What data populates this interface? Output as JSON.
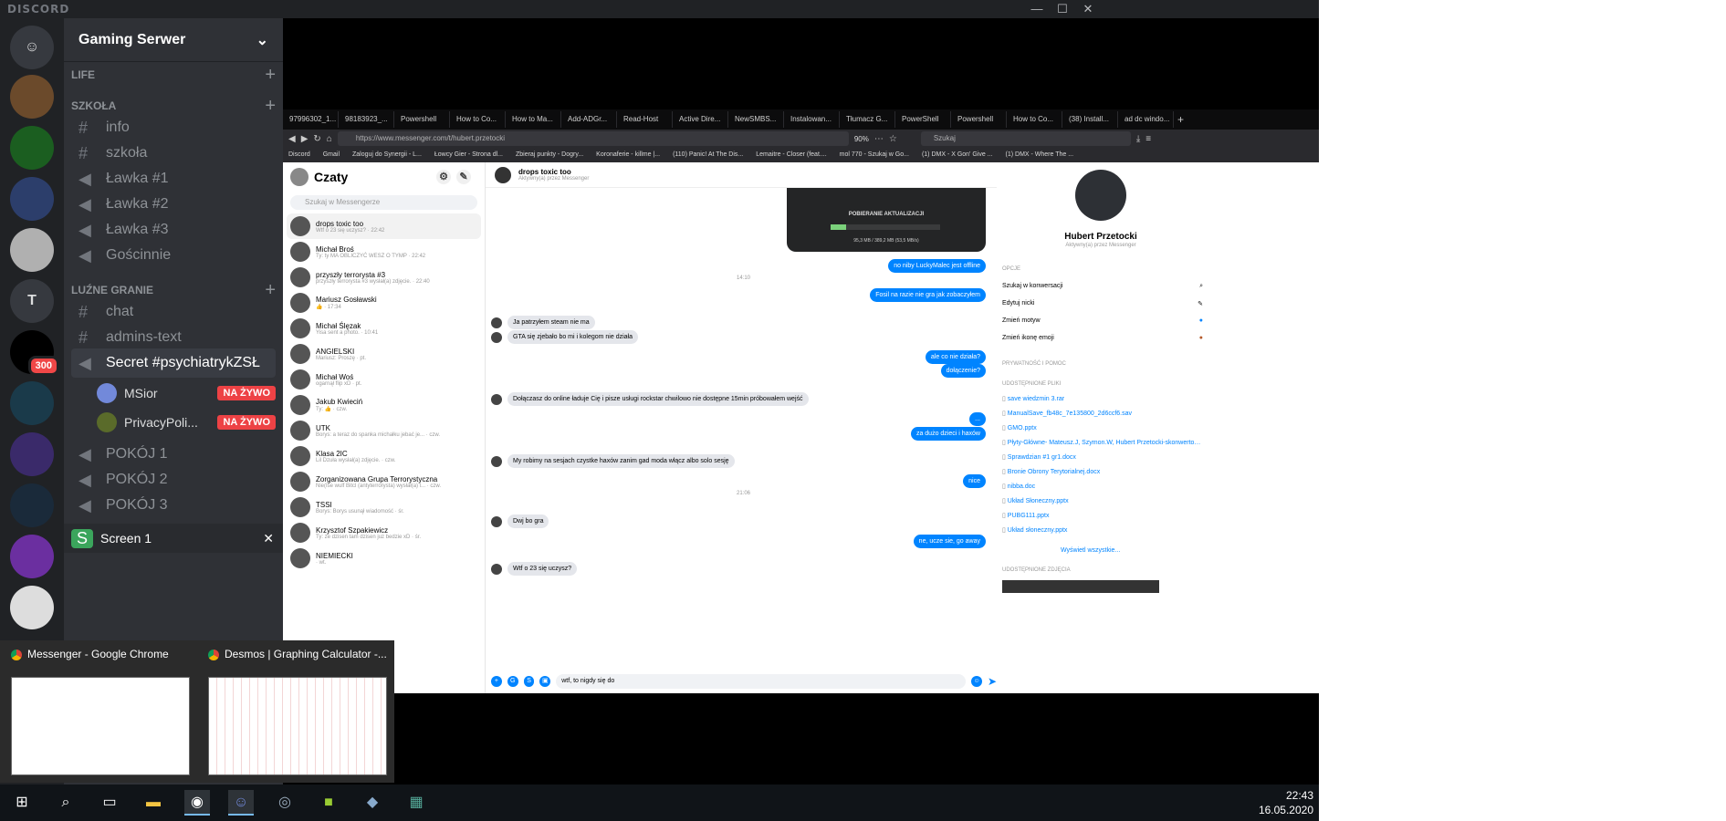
{
  "discord": {
    "logo": "DISCORD",
    "server_name": "Gaming Serwer",
    "categories": [
      "LIFE",
      "SZKOŁA",
      "LUŹNE GRANIE"
    ],
    "channels_szkola": [
      "info",
      "szkoła",
      "Ławka #1",
      "Ławka #2",
      "Ławka #3",
      "Gościnnie"
    ],
    "channels_luzne": [
      "chat",
      "admins-text",
      "Secret #psychiatrykZSŁ"
    ],
    "voice_users": [
      {
        "name": "MSior",
        "badge": "NA ŻYWO"
      },
      {
        "name": "PrivacyPoli...",
        "badge": "NA ŻYWO"
      }
    ],
    "more_channels": [
      "POKÓJ 1",
      "POKÓJ 2",
      "POKÓJ 3"
    ],
    "screen_share": "Screen 1",
    "server_letter": "T",
    "mention_count": "300"
  },
  "browser": {
    "tabs": [
      "97996302_1...",
      "98183923_...",
      "Powershell",
      "How to Co...",
      "How to Ma...",
      "Add-ADGr...",
      "Read-Host",
      "Active Dire...",
      "NewSMBS...",
      "Instalowan...",
      "Tłumacz G...",
      "PowerShell",
      "Powershell",
      "How to Co...",
      "(38) Install...",
      "ad dc windo..."
    ],
    "url": "https://www.messenger.com/t/hubert.przetocki",
    "zoom": "90%",
    "search_placeholder": "Szukaj",
    "bookmarks": [
      "Discord",
      "Gmail",
      "Zaloguj do Synergii - L...",
      "Łowcy Gier - Strona dl...",
      "Zbieraj punkty - Dogry...",
      "Koronaferie - killme |...",
      "(110) Panic! At The Dis...",
      "Lemaitre - Closer (feat....",
      "mol 770 - Szukaj w Go...",
      "(1) DMX - X Gon' Give ...",
      "(1) DMX - Where The ..."
    ]
  },
  "messenger": {
    "title": "Czaty",
    "search_placeholder": "Szukaj w Messengerze",
    "conversations": [
      {
        "name": "drops toxic too",
        "preview": "Wtf o 23 się uczysz? · 22:42"
      },
      {
        "name": "Michał Broś",
        "preview": "Ty: ty MA OBLICZYĆ WESZ O TYMP · 22:42"
      },
      {
        "name": "przyszły terrorysta #3",
        "preview": "przyszły terrorysta #3 wysłał(a) zdjęcie. · 22:40"
      },
      {
        "name": "Mariusz Gosławski",
        "preview": "👍 · 17:34"
      },
      {
        "name": "Michał Ślęzak",
        "preview": "Yisa sent a photo. · 10:41"
      },
      {
        "name": "ANGIELSKI",
        "preview": "Mariusz: Proszę · pt."
      },
      {
        "name": "Michał Woś",
        "preview": "ogarnął flip xD · pt."
      },
      {
        "name": "Jakub Kwieciń",
        "preview": "Ty: 👍 · czw."
      },
      {
        "name": "UTK",
        "preview": "Borys: a teraz do spanka michałku jebać je... · czw."
      },
      {
        "name": "Klasa 2IC",
        "preview": "Lil Dzuła wysłał(a) zdjęcie. · czw."
      },
      {
        "name": "Zorganizowana Grupa Terrorystyczna",
        "preview": "Nie(Ise wulf Bitcl (antyterrorysta) wysłał(a) l... · czw."
      },
      {
        "name": "TSSI",
        "preview": "Borys: Borys usunął wiadomość · śr."
      },
      {
        "name": "Krzysztof Szpakiewicz",
        "preview": "Ty: ze dzisen tam dzisen juz bedzie xD · śr."
      },
      {
        "name": "NIEMIECKI",
        "preview": "· wt."
      }
    ],
    "active_name": "drops toxic too",
    "active_status": "Aktywny(a) przez Messenger",
    "update_card": {
      "title": "POBIERANIE AKTUALIZACJI",
      "size": "95,3 MB / 389,2 MB (53,5 MB/s)",
      "progress": 0.14
    },
    "messages": [
      {
        "dir": "out",
        "text": "no niby LuckyMalec jest offline"
      },
      {
        "dir": "time",
        "text": "14:10"
      },
      {
        "dir": "out",
        "text": "Fosil na razie nie gra jak zobaczyłem"
      },
      {
        "dir": "in",
        "text": "Ja patrzyłem steam nie ma"
      },
      {
        "dir": "in",
        "text": "GTA się zjebało bo mi i kolegom nie działa"
      },
      {
        "dir": "out",
        "text": "ale co nie działa?"
      },
      {
        "dir": "out",
        "text": "dołączenie?"
      },
      {
        "dir": "in",
        "text": "Dołączasz do online ładuje Cię i pisze usługi rockstar chwilowo nie dostępne 15min próbowałem wejść"
      },
      {
        "dir": "out",
        "text": "..."
      },
      {
        "dir": "out",
        "text": "za dużo dzieci i haxów"
      },
      {
        "dir": "in",
        "text": "My robimy na sesjach czystke haxów zanim gad moda włącz albo solo sesję"
      },
      {
        "dir": "out",
        "text": "nice"
      },
      {
        "dir": "time",
        "text": "21:06"
      },
      {
        "dir": "in",
        "text": "Dwj bo gra"
      },
      {
        "dir": "out",
        "text": "ne, ucze sie, go away"
      },
      {
        "dir": "in",
        "text": "Wtf o 23 się uczysz?"
      }
    ],
    "composer_text": "wtf, to nigdy się do",
    "profile": {
      "name": "Hubert Przetocki",
      "status": "Aktywny(a) przez Messenger"
    },
    "sections": [
      "OPCJE",
      "PRYWATNOŚĆ I POMOC",
      "UDOSTĘPNIONE PLIKI",
      "UDOSTĘPNIONE ZDJĘCIA"
    ],
    "options": [
      "Szukaj w konwersacji",
      "Edytuj nicki",
      "Zmień motyw",
      "Zmień ikonę emoji"
    ],
    "files": [
      "save wiedzmin 3.rar",
      "ManualSave_fb48c_7e135800_2d6ccf6.sav",
      "GMO.pptx",
      "Płyty-Główne- Mateusz.J, Szymon.W, Hubert Przetocki-skonwertowany (1).pdf",
      "Sprawdzian #1 gr1.docx",
      "Bronie Obrony Terytorialnej.docx",
      "nibba.doc",
      "Układ Słoneczny.pptx",
      "PUBG111.pptx",
      "Układ słoneczny.pptx"
    ],
    "see_all": "Wyświetl wszystkie..."
  },
  "alttab": [
    {
      "title": "Messenger - Google Chrome"
    },
    {
      "title": "Desmos | Graphing Calculator -..."
    }
  ],
  "taskbar": {
    "time": "22:43",
    "date": "16.05.2020"
  }
}
